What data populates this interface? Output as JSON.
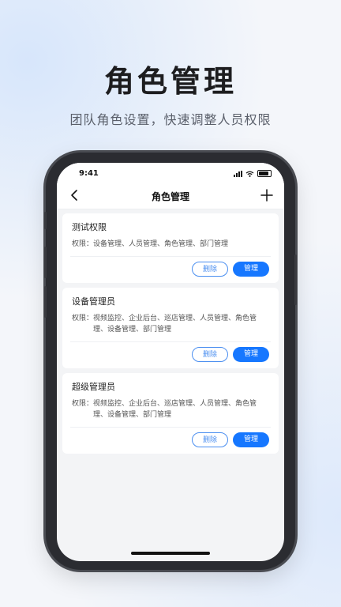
{
  "hero": {
    "title": "角色管理",
    "subtitle": "团队角色设置，快速调整人员权限"
  },
  "status_bar": {
    "time": "9:41"
  },
  "nav": {
    "back_icon": "chevron-left-icon",
    "title": "角色管理",
    "add_icon": "plus-icon"
  },
  "roles": [
    {
      "name": "测试权限",
      "perm_label": "权限：",
      "permissions": "设备管理、人员管理、角色管理、部门管理",
      "delete_label": "删除",
      "manage_label": "管理"
    },
    {
      "name": "设备管理员",
      "perm_label": "权限：",
      "permissions": "视频监控、企业后台、巡店管理、人员管理、角色管理、设备管理、部门管理",
      "delete_label": "删除",
      "manage_label": "管理"
    },
    {
      "name": "超级管理员",
      "perm_label": "权限：",
      "permissions": "视频监控、企业后台、巡店管理、人员管理、角色管理、设备管理、部门管理",
      "delete_label": "删除",
      "manage_label": "管理"
    }
  ],
  "colors": {
    "accent": "#1677ff",
    "outline": "#4a8ef0",
    "background": "#f3f4f6"
  }
}
